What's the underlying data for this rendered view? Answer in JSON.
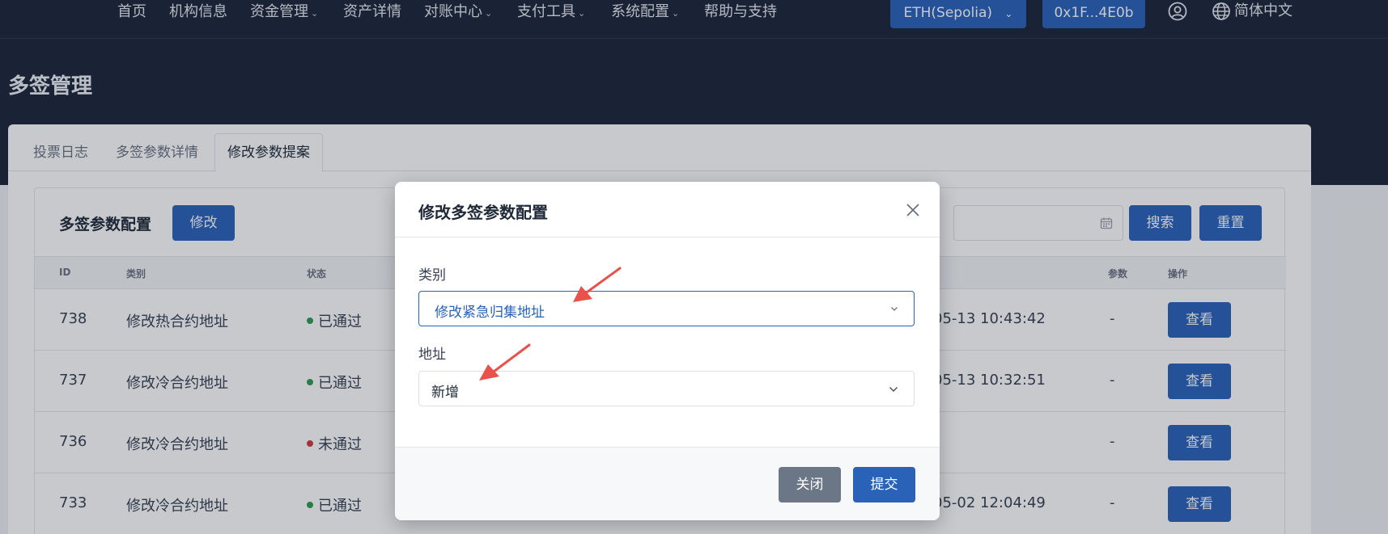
{
  "nav": {
    "items": [
      {
        "label": "首页",
        "dropdown": false
      },
      {
        "label": "机构信息",
        "dropdown": false
      },
      {
        "label": "资金管理",
        "dropdown": true
      },
      {
        "label": "资产详情",
        "dropdown": false
      },
      {
        "label": "对账中心",
        "dropdown": true
      },
      {
        "label": "支付工具",
        "dropdown": true
      },
      {
        "label": "系统配置",
        "dropdown": true
      },
      {
        "label": "帮助与支持",
        "dropdown": false
      }
    ],
    "network": "ETH(Sepolia)",
    "wallet": "0x1F...4E0b",
    "language": "简体中文"
  },
  "page": {
    "title": "多签管理"
  },
  "tabs": [
    {
      "label": "投票日志",
      "active": false
    },
    {
      "label": "多签参数详情",
      "active": false
    },
    {
      "label": "修改参数提案",
      "active": true
    }
  ],
  "panel": {
    "title": "多签参数配置",
    "edit_label": "修改",
    "search_label": "搜索",
    "reset_label": "重置"
  },
  "table": {
    "columns": [
      "ID",
      "类别",
      "状态",
      "参数",
      "操作"
    ],
    "rows": [
      {
        "id": "738",
        "category": "修改热合约地址",
        "status": "已通过",
        "status_color": "#2e9d4f",
        "time": "05-13 10:43:42",
        "param": "-",
        "action": "查看"
      },
      {
        "id": "737",
        "category": "修改冷合约地址",
        "status": "已通过",
        "status_color": "#2e9d4f",
        "time": "05-13 10:32:51",
        "param": "-",
        "action": "查看"
      },
      {
        "id": "736",
        "category": "修改冷合约地址",
        "status": "未通过",
        "status_color": "#d23b3b",
        "time": "",
        "param": "-",
        "action": "查看"
      },
      {
        "id": "733",
        "category": "修改冷合约地址",
        "status": "已通过",
        "status_color": "#2e9d4f",
        "time": "05-02 12:04:49",
        "param": "-",
        "action": "查看"
      }
    ]
  },
  "modal": {
    "title": "修改多签参数配置",
    "category_label": "类别",
    "category_value": "修改紧急归集地址",
    "address_label": "地址",
    "address_value": "新增",
    "close_label": "关闭",
    "submit_label": "提交"
  },
  "colors": {
    "primary": "#2a62b8",
    "header_bg": "#1b2538",
    "annotation_arrow": "#e8524a"
  }
}
